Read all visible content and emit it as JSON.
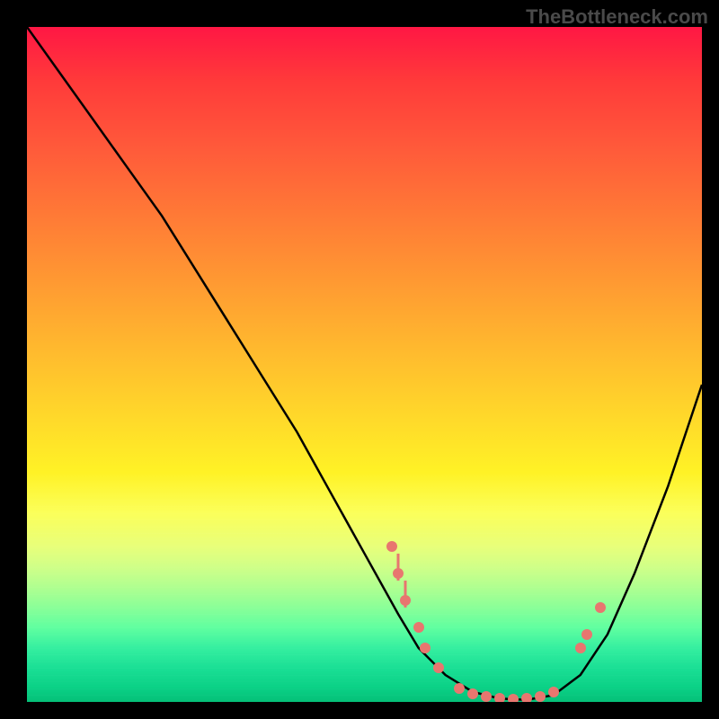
{
  "watermark": "TheBottleneck.com",
  "chart_data": {
    "type": "line",
    "title": "",
    "xlabel": "",
    "ylabel": "",
    "xlim": [
      0,
      100
    ],
    "ylim": [
      0,
      100
    ],
    "curve": {
      "x": [
        0,
        5,
        10,
        15,
        20,
        25,
        30,
        35,
        40,
        45,
        50,
        55,
        58,
        62,
        66,
        70,
        74,
        78,
        82,
        86,
        90,
        95,
        100
      ],
      "y": [
        100,
        93,
        86,
        79,
        72,
        64,
        56,
        48,
        40,
        31,
        22,
        13,
        8,
        4,
        1.5,
        0.5,
        0.3,
        1,
        4,
        10,
        19,
        32,
        47
      ]
    },
    "dots": [
      {
        "x": 54,
        "y": 23
      },
      {
        "x": 55,
        "y": 19
      },
      {
        "x": 56,
        "y": 15
      },
      {
        "x": 58,
        "y": 11
      },
      {
        "x": 59,
        "y": 8
      },
      {
        "x": 61,
        "y": 5
      },
      {
        "x": 64,
        "y": 2
      },
      {
        "x": 66,
        "y": 1.2
      },
      {
        "x": 68,
        "y": 0.8
      },
      {
        "x": 70,
        "y": 0.5
      },
      {
        "x": 72,
        "y": 0.4
      },
      {
        "x": 74,
        "y": 0.5
      },
      {
        "x": 76,
        "y": 0.8
      },
      {
        "x": 78,
        "y": 1.5
      },
      {
        "x": 82,
        "y": 8
      },
      {
        "x": 83,
        "y": 10
      },
      {
        "x": 85,
        "y": 14
      }
    ],
    "ticks": [
      {
        "x": 56,
        "y_top": 18,
        "y_bot": 14
      },
      {
        "x": 55,
        "y_top": 22,
        "y_bot": 18
      }
    ],
    "background_gradient": {
      "top": "#ff1744",
      "mid": "#fff226",
      "bottom": "#05c078"
    }
  }
}
